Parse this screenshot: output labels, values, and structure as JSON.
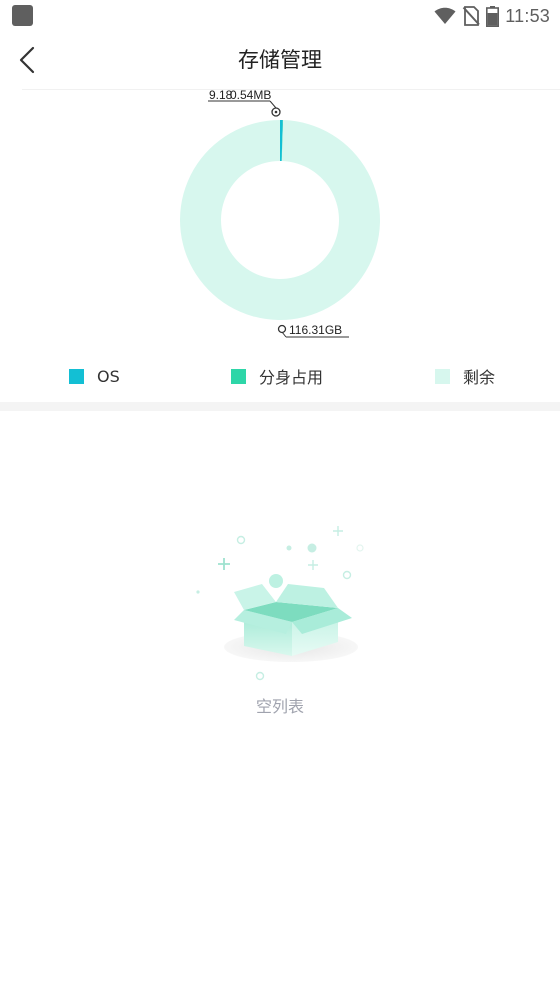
{
  "status_bar": {
    "time": "11:53",
    "icons": [
      "app-square-icon",
      "wifi-icon",
      "no-sim-icon",
      "battery-icon"
    ]
  },
  "header": {
    "title": "存储管理",
    "back_icon": "chevron-left-icon"
  },
  "chart_data": {
    "type": "pie",
    "style": "donut",
    "slices": [
      {
        "label": "OS",
        "value_label": "9.18",
        "color": "#13bfd4"
      },
      {
        "label": "分身占用",
        "value_label": "0.54MB",
        "color": "#2ed6a8"
      },
      {
        "label": "剩余",
        "value_label": "116.31GB",
        "color": "#d7f7ee"
      }
    ],
    "legend_placement": "bottom"
  },
  "legend": {
    "items": [
      {
        "label": "OS",
        "color": "#13bfd4"
      },
      {
        "label": "分身占用",
        "color": "#2ed6a8"
      },
      {
        "label": "剩余",
        "color": "#d7f7ee"
      }
    ]
  },
  "empty_state": {
    "label": "空列表",
    "icon": "open-box-icon"
  }
}
